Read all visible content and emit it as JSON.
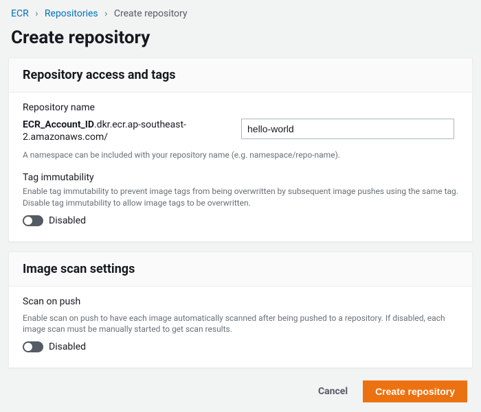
{
  "breadcrumb": {
    "items": [
      {
        "label": "ECR"
      },
      {
        "label": "Repositories"
      }
    ],
    "current": "Create repository"
  },
  "page_title": "Create repository",
  "panels": {
    "access": {
      "title": "Repository access and tags",
      "repo_name_label": "Repository name",
      "account_id_var": "ECR_Account_ID",
      "registry_uri_suffix": ".dkr.ecr.ap-southeast-2.amazonaws.com/",
      "repo_name_value": "hello-world",
      "namespace_hint": "A namespace can be included with your repository name (e.g. namespace/repo-name).",
      "tag_immutability": {
        "label": "Tag immutability",
        "description": "Enable tag immutability to prevent image tags from being overwritten by subsequent image pushes using the same tag. Disable tag immutability to allow image tags to be overwritten.",
        "state_label": "Disabled"
      }
    },
    "scan": {
      "title": "Image scan settings",
      "scan_on_push": {
        "label": "Scan on push",
        "description": "Enable scan on push to have each image automatically scanned after being pushed to a repository. If disabled, each image scan must be manually started to get scan results.",
        "state_label": "Disabled"
      }
    }
  },
  "footer": {
    "cancel_label": "Cancel",
    "submit_label": "Create repository"
  }
}
